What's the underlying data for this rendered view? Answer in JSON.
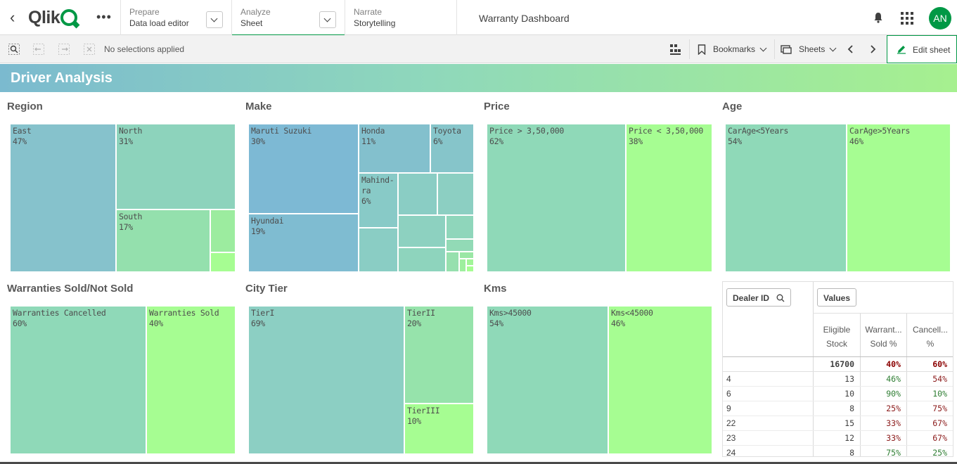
{
  "nav": {
    "logo": "Qlik",
    "prepare": {
      "small": "Prepare",
      "big": "Data load editor"
    },
    "analyze": {
      "small": "Analyze",
      "big": "Sheet"
    },
    "narrate": {
      "small": "Narrate",
      "big": "Storytelling"
    },
    "app_title": "Warranty Dashboard",
    "avatar": "AN"
  },
  "toolbar": {
    "selections": "No selections applied",
    "bookmarks": "Bookmarks",
    "sheets": "Sheets",
    "edit_sheet": "Edit sheet"
  },
  "sheet_title": "Driver Analysis",
  "colors": {
    "blue": "#7db9d4",
    "teal": "#8ccfc3",
    "mint": "#93ddb3",
    "green": "#a6fd92"
  },
  "panels": {
    "region": {
      "title": "Region",
      "cells": [
        {
          "name": "East",
          "pct": "47%"
        },
        {
          "name": "North",
          "pct": "31%"
        },
        {
          "name": "South",
          "pct": "17%"
        }
      ]
    },
    "make": {
      "title": "Make",
      "cells": [
        {
          "name": "Maruti Suzuki",
          "pct": "30%"
        },
        {
          "name": "Honda",
          "pct": "11%"
        },
        {
          "name": "Toyota",
          "pct": "6%"
        },
        {
          "name": "Mahind-ra",
          "pct": "6%"
        },
        {
          "name": "Hyundai",
          "pct": "19%"
        }
      ]
    },
    "price": {
      "title": "Price",
      "cells": [
        {
          "name": "Price > 3,50,000",
          "pct": "62%"
        },
        {
          "name": "Price < 3,50,000",
          "pct": "38%"
        }
      ]
    },
    "age": {
      "title": "Age",
      "cells": [
        {
          "name": "CarAge<5Years",
          "pct": "54%"
        },
        {
          "name": "CarAge>5Years",
          "pct": "46%"
        }
      ]
    },
    "warranty": {
      "title": "Warranties Sold/Not Sold",
      "cells": [
        {
          "name": "Warranties Cancelled",
          "pct": "60%"
        },
        {
          "name": "Warranties Sold",
          "pct": "40%"
        }
      ]
    },
    "city": {
      "title": "City Tier",
      "cells": [
        {
          "name": "TierI",
          "pct": "69%"
        },
        {
          "name": "TierII",
          "pct": "20%"
        },
        {
          "name": "TierIII",
          "pct": "10%"
        }
      ]
    },
    "kms": {
      "title": "Kms",
      "cells": [
        {
          "name": "Kms>45000",
          "pct": "54%"
        },
        {
          "name": "Kms<45000",
          "pct": "46%"
        }
      ]
    }
  },
  "table": {
    "dim_button": "Dealer ID",
    "values_button": "Values",
    "headers": [
      {
        "line1": "Eligible",
        "line2": "Stock"
      },
      {
        "line1": "Warrant...",
        "line2": "Sold %"
      },
      {
        "line1": "Cancell...",
        "line2": "%"
      }
    ],
    "totals": {
      "eligible": "16700",
      "sold": "40%",
      "cancel": "60%"
    },
    "rows": [
      {
        "id": "4",
        "eligible": "13",
        "sold": "46%",
        "cancel": "54%"
      },
      {
        "id": "6",
        "eligible": "10",
        "sold": "90%",
        "cancel": "10%"
      },
      {
        "id": "9",
        "eligible": "8",
        "sold": "25%",
        "cancel": "75%"
      },
      {
        "id": "22",
        "eligible": "15",
        "sold": "33%",
        "cancel": "67%"
      },
      {
        "id": "23",
        "eligible": "12",
        "sold": "33%",
        "cancel": "67%"
      },
      {
        "id": "24",
        "eligible": "8",
        "sold": "75%",
        "cancel": "25%"
      }
    ]
  }
}
